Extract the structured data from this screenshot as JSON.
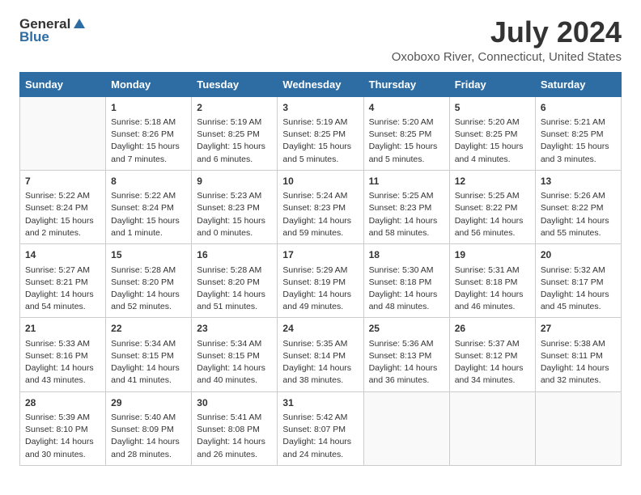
{
  "logo": {
    "general": "General",
    "blue": "Blue"
  },
  "title": "July 2024",
  "subtitle": "Oxoboxo River, Connecticut, United States",
  "header": {
    "days": [
      "Sunday",
      "Monday",
      "Tuesday",
      "Wednesday",
      "Thursday",
      "Friday",
      "Saturday"
    ]
  },
  "weeks": [
    {
      "bg": "row-bg-1",
      "days": [
        {
          "num": "",
          "empty": true
        },
        {
          "num": "1",
          "text": "Sunrise: 5:18 AM\nSunset: 8:26 PM\nDaylight: 15 hours\nand 7 minutes."
        },
        {
          "num": "2",
          "text": "Sunrise: 5:19 AM\nSunset: 8:25 PM\nDaylight: 15 hours\nand 6 minutes."
        },
        {
          "num": "3",
          "text": "Sunrise: 5:19 AM\nSunset: 8:25 PM\nDaylight: 15 hours\nand 5 minutes."
        },
        {
          "num": "4",
          "text": "Sunrise: 5:20 AM\nSunset: 8:25 PM\nDaylight: 15 hours\nand 5 minutes."
        },
        {
          "num": "5",
          "text": "Sunrise: 5:20 AM\nSunset: 8:25 PM\nDaylight: 15 hours\nand 4 minutes."
        },
        {
          "num": "6",
          "text": "Sunrise: 5:21 AM\nSunset: 8:25 PM\nDaylight: 15 hours\nand 3 minutes."
        }
      ]
    },
    {
      "bg": "row-bg-2",
      "days": [
        {
          "num": "7",
          "text": "Sunrise: 5:22 AM\nSunset: 8:24 PM\nDaylight: 15 hours\nand 2 minutes."
        },
        {
          "num": "8",
          "text": "Sunrise: 5:22 AM\nSunset: 8:24 PM\nDaylight: 15 hours\nand 1 minute."
        },
        {
          "num": "9",
          "text": "Sunrise: 5:23 AM\nSunset: 8:23 PM\nDaylight: 15 hours\nand 0 minutes."
        },
        {
          "num": "10",
          "text": "Sunrise: 5:24 AM\nSunset: 8:23 PM\nDaylight: 14 hours\nand 59 minutes."
        },
        {
          "num": "11",
          "text": "Sunrise: 5:25 AM\nSunset: 8:23 PM\nDaylight: 14 hours\nand 58 minutes."
        },
        {
          "num": "12",
          "text": "Sunrise: 5:25 AM\nSunset: 8:22 PM\nDaylight: 14 hours\nand 56 minutes."
        },
        {
          "num": "13",
          "text": "Sunrise: 5:26 AM\nSunset: 8:22 PM\nDaylight: 14 hours\nand 55 minutes."
        }
      ]
    },
    {
      "bg": "row-bg-1",
      "days": [
        {
          "num": "14",
          "text": "Sunrise: 5:27 AM\nSunset: 8:21 PM\nDaylight: 14 hours\nand 54 minutes."
        },
        {
          "num": "15",
          "text": "Sunrise: 5:28 AM\nSunset: 8:20 PM\nDaylight: 14 hours\nand 52 minutes."
        },
        {
          "num": "16",
          "text": "Sunrise: 5:28 AM\nSunset: 8:20 PM\nDaylight: 14 hours\nand 51 minutes."
        },
        {
          "num": "17",
          "text": "Sunrise: 5:29 AM\nSunset: 8:19 PM\nDaylight: 14 hours\nand 49 minutes."
        },
        {
          "num": "18",
          "text": "Sunrise: 5:30 AM\nSunset: 8:18 PM\nDaylight: 14 hours\nand 48 minutes."
        },
        {
          "num": "19",
          "text": "Sunrise: 5:31 AM\nSunset: 8:18 PM\nDaylight: 14 hours\nand 46 minutes."
        },
        {
          "num": "20",
          "text": "Sunrise: 5:32 AM\nSunset: 8:17 PM\nDaylight: 14 hours\nand 45 minutes."
        }
      ]
    },
    {
      "bg": "row-bg-2",
      "days": [
        {
          "num": "21",
          "text": "Sunrise: 5:33 AM\nSunset: 8:16 PM\nDaylight: 14 hours\nand 43 minutes."
        },
        {
          "num": "22",
          "text": "Sunrise: 5:34 AM\nSunset: 8:15 PM\nDaylight: 14 hours\nand 41 minutes."
        },
        {
          "num": "23",
          "text": "Sunrise: 5:34 AM\nSunset: 8:15 PM\nDaylight: 14 hours\nand 40 minutes."
        },
        {
          "num": "24",
          "text": "Sunrise: 5:35 AM\nSunset: 8:14 PM\nDaylight: 14 hours\nand 38 minutes."
        },
        {
          "num": "25",
          "text": "Sunrise: 5:36 AM\nSunset: 8:13 PM\nDaylight: 14 hours\nand 36 minutes."
        },
        {
          "num": "26",
          "text": "Sunrise: 5:37 AM\nSunset: 8:12 PM\nDaylight: 14 hours\nand 34 minutes."
        },
        {
          "num": "27",
          "text": "Sunrise: 5:38 AM\nSunset: 8:11 PM\nDaylight: 14 hours\nand 32 minutes."
        }
      ]
    },
    {
      "bg": "row-bg-1",
      "days": [
        {
          "num": "28",
          "text": "Sunrise: 5:39 AM\nSunset: 8:10 PM\nDaylight: 14 hours\nand 30 minutes."
        },
        {
          "num": "29",
          "text": "Sunrise: 5:40 AM\nSunset: 8:09 PM\nDaylight: 14 hours\nand 28 minutes."
        },
        {
          "num": "30",
          "text": "Sunrise: 5:41 AM\nSunset: 8:08 PM\nDaylight: 14 hours\nand 26 minutes."
        },
        {
          "num": "31",
          "text": "Sunrise: 5:42 AM\nSunset: 8:07 PM\nDaylight: 14 hours\nand 24 minutes."
        },
        {
          "num": "",
          "empty": true
        },
        {
          "num": "",
          "empty": true
        },
        {
          "num": "",
          "empty": true
        }
      ]
    }
  ]
}
